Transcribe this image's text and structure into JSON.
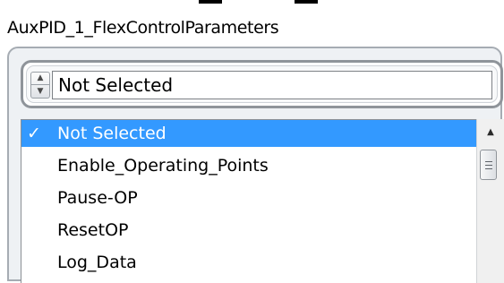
{
  "window": {
    "title": "AuxPID_1_FlexControlParameters"
  },
  "combo": {
    "value": "Not Selected"
  },
  "list": {
    "items": [
      {
        "label": "Not Selected",
        "check": "✓",
        "selected": true
      },
      {
        "label": "Enable_Operating_Points",
        "check": "",
        "selected": false
      },
      {
        "label": "Pause-OP",
        "check": "",
        "selected": false
      },
      {
        "label": "ResetOP",
        "check": "",
        "selected": false
      },
      {
        "label": "Log_Data",
        "check": "",
        "selected": false
      }
    ]
  },
  "colors": {
    "selection": "#3399ff",
    "selection_text": "#ffffff",
    "panel": "#eef1f4"
  },
  "icons": {
    "spinner_up": "▲",
    "spinner_down": "▼",
    "scroll_up": "▲"
  }
}
